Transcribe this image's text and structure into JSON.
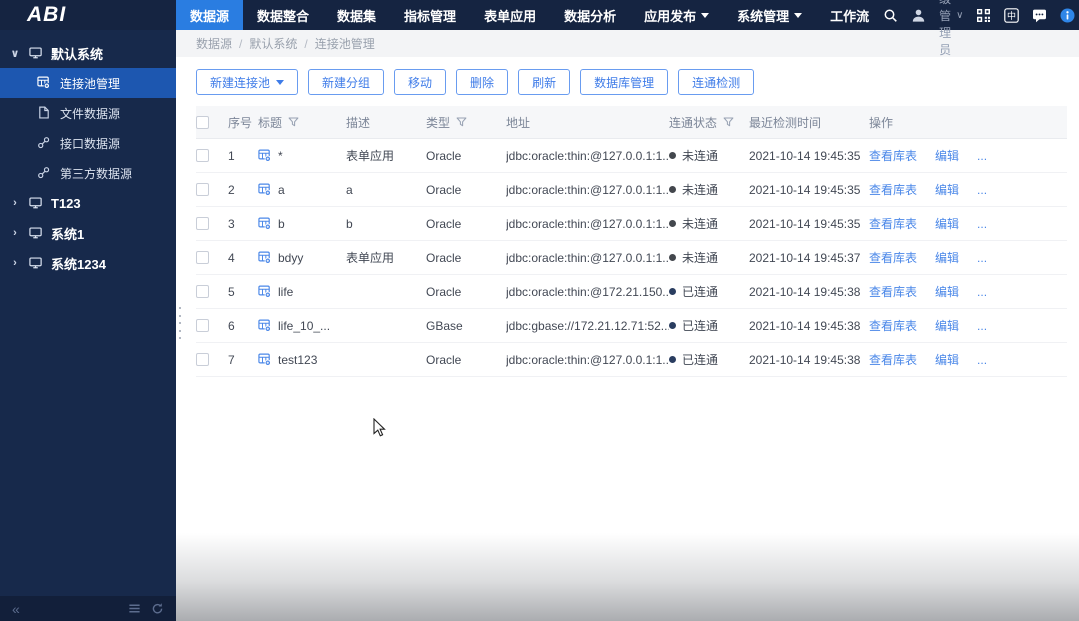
{
  "brand": {
    "logo": "ABI"
  },
  "topnav": {
    "tabs": [
      {
        "name": "data-source",
        "label": "数据源",
        "active": true,
        "dropdown": false
      },
      {
        "name": "data-integration",
        "label": "数据整合",
        "active": false,
        "dropdown": false
      },
      {
        "name": "dataset",
        "label": "数据集",
        "active": false,
        "dropdown": false
      },
      {
        "name": "indicator-management",
        "label": "指标管理",
        "active": false,
        "dropdown": false
      },
      {
        "name": "form-application",
        "label": "表单应用",
        "active": false,
        "dropdown": false
      },
      {
        "name": "data-analysis",
        "label": "数据分析",
        "active": false,
        "dropdown": false
      },
      {
        "name": "app-publish",
        "label": "应用发布",
        "active": false,
        "dropdown": true
      },
      {
        "name": "system-management",
        "label": "系统管理",
        "active": false,
        "dropdown": true
      },
      {
        "name": "workflow",
        "label": "工作流",
        "active": false,
        "dropdown": false
      }
    ],
    "user": {
      "name": "超级管理员"
    },
    "right_icons": [
      "search-icon",
      "user-avatar-icon",
      "qrcode-icon",
      "language-zh-icon",
      "message-icon",
      "info-icon"
    ]
  },
  "sidebar": {
    "tree": [
      {
        "name": "default-system",
        "label": "默认系统",
        "expanded": true,
        "children": [
          {
            "name": "connection-pool-management",
            "label": "连接池管理",
            "icon": "database-icon",
            "active": true
          },
          {
            "name": "file-datasource",
            "label": "文件数据源",
            "icon": "file-icon",
            "active": false
          },
          {
            "name": "api-datasource",
            "label": "接口数据源",
            "icon": "link-icon",
            "active": false
          },
          {
            "name": "third-party-datasource",
            "label": "第三方数据源",
            "icon": "link-icon",
            "active": false
          }
        ]
      },
      {
        "name": "t123",
        "label": "T123",
        "expanded": false,
        "children": []
      },
      {
        "name": "system1",
        "label": "系统1",
        "expanded": false,
        "children": []
      },
      {
        "name": "system1234",
        "label": "系统1234",
        "expanded": false,
        "children": []
      }
    ]
  },
  "breadcrumb": {
    "separator": "/",
    "items": [
      "数据源",
      "默认系统",
      "连接池管理"
    ]
  },
  "toolbar": {
    "buttons": [
      {
        "name": "new-connection-pool",
        "label": "新建连接池",
        "dropdown": true
      },
      {
        "name": "new-group",
        "label": "新建分组",
        "dropdown": false
      },
      {
        "name": "move",
        "label": "移动",
        "dropdown": false
      },
      {
        "name": "delete",
        "label": "删除",
        "dropdown": false
      },
      {
        "name": "refresh",
        "label": "刷新",
        "dropdown": false
      },
      {
        "name": "database-management",
        "label": "数据库管理",
        "dropdown": false
      },
      {
        "name": "connectivity-check",
        "label": "连通检测",
        "dropdown": false
      }
    ]
  },
  "table": {
    "columns": [
      {
        "name": "no",
        "label": "序号",
        "filter": false
      },
      {
        "name": "title",
        "label": "标题",
        "filter": true
      },
      {
        "name": "description",
        "label": "描述",
        "filter": false
      },
      {
        "name": "type",
        "label": "类型",
        "filter": true
      },
      {
        "name": "address",
        "label": "地址",
        "filter": false
      },
      {
        "name": "status",
        "label": "连通状态",
        "filter": true
      },
      {
        "name": "last-check-time",
        "label": "最近检测时间",
        "filter": false
      },
      {
        "name": "actions",
        "label": "操作",
        "filter": false
      }
    ],
    "actions": [
      "查看库表",
      "编辑",
      "..."
    ],
    "rows": [
      {
        "no": "1",
        "title": "*",
        "desc": "表单应用",
        "type": "Oracle",
        "address": "jdbc:oracle:thin:@127.0.0.1:1...",
        "status": "未连通",
        "connected": false,
        "time": "2021-10-14 19:45:35"
      },
      {
        "no": "2",
        "title": "a",
        "desc": "a",
        "type": "Oracle",
        "address": "jdbc:oracle:thin:@127.0.0.1:1...",
        "status": "未连通",
        "connected": false,
        "time": "2021-10-14 19:45:35"
      },
      {
        "no": "3",
        "title": "b",
        "desc": "b",
        "type": "Oracle",
        "address": "jdbc:oracle:thin:@127.0.0.1:1...",
        "status": "未连通",
        "connected": false,
        "time": "2021-10-14 19:45:35"
      },
      {
        "no": "4",
        "title": "bdyy",
        "desc": "表单应用",
        "type": "Oracle",
        "address": "jdbc:oracle:thin:@127.0.0.1:1...",
        "status": "未连通",
        "connected": false,
        "time": "2021-10-14 19:45:37"
      },
      {
        "no": "5",
        "title": "life",
        "desc": "",
        "type": "Oracle",
        "address": "jdbc:oracle:thin:@172.21.150....",
        "status": "已连通",
        "connected": true,
        "time": "2021-10-14 19:45:38"
      },
      {
        "no": "6",
        "title": "life_10_...",
        "desc": "",
        "type": "GBase",
        "address": "jdbc:gbase://172.21.12.71:52...",
        "status": "已连通",
        "connected": true,
        "time": "2021-10-14 19:45:38"
      },
      {
        "no": "7",
        "title": "test123",
        "desc": "",
        "type": "Oracle",
        "address": "jdbc:oracle:thin:@127.0.0.1:1...",
        "status": "已连通",
        "connected": true,
        "time": "2021-10-14 19:45:38"
      }
    ]
  },
  "colors": {
    "accent": "#2a7de1",
    "link": "#4a87e8",
    "topbar_bg": "#152441",
    "sidebar_bg": "#17294b",
    "active_item_bg": "#1d57b0",
    "status_connected_dot": "#2a3d60",
    "status_disconnected_dot": "#43474d"
  }
}
